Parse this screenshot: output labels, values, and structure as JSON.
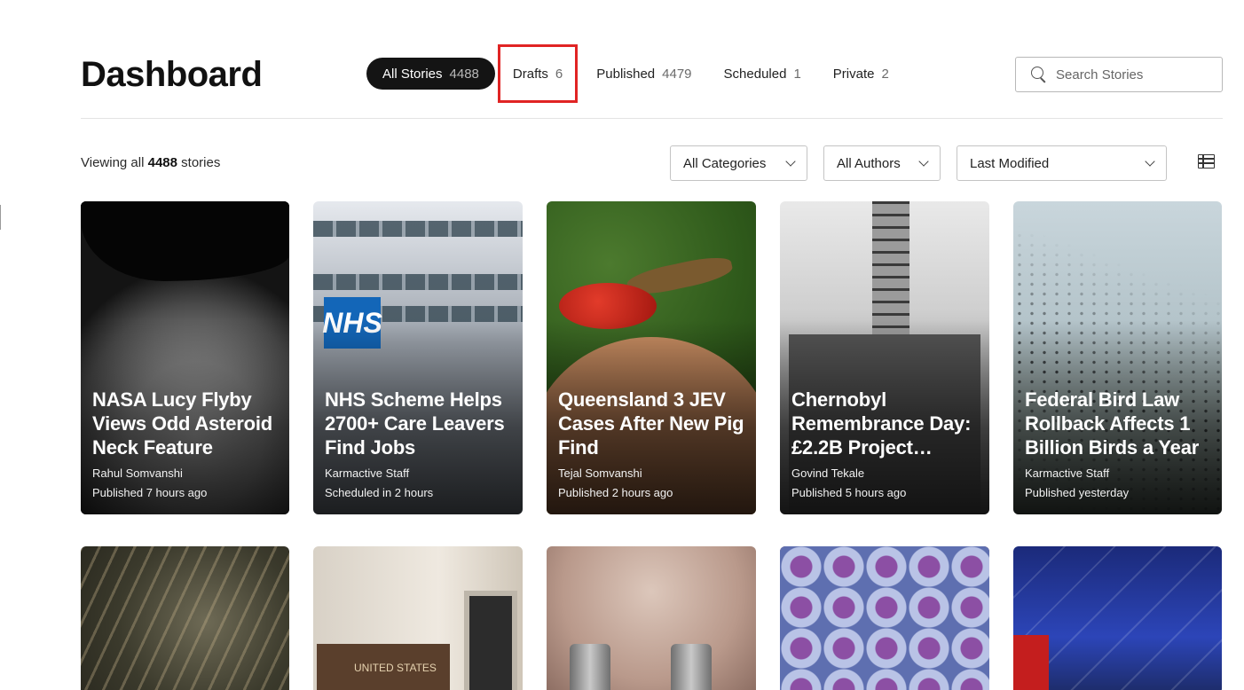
{
  "header": {
    "title": "Dashboard",
    "tabs": [
      {
        "label": "All Stories",
        "count": "4488"
      },
      {
        "label": "Drafts",
        "count": "6"
      },
      {
        "label": "Published",
        "count": "4479"
      },
      {
        "label": "Scheduled",
        "count": "1"
      },
      {
        "label": "Private",
        "count": "2"
      }
    ],
    "search": {
      "placeholder": "Search Stories"
    }
  },
  "filters": {
    "viewing_prefix": "Viewing all",
    "viewing_count": "4488",
    "viewing_suffix": "stories",
    "category": "All Categories",
    "author": "All Authors",
    "sort": "Last Modified"
  },
  "stories": [
    {
      "title": "NASA Lucy Flyby Views Odd Asteroid Neck Feature",
      "author": "Rahul Somvanshi",
      "status": "Published 7 hours ago"
    },
    {
      "title": "NHS Scheme Helps 2700+ Care Leavers Find Jobs",
      "author": "Karmactive Staff",
      "status": "Scheduled in 2 hours"
    },
    {
      "title": "Queensland 3 JEV Cases After New Pig Find",
      "author": "Tejal Somvanshi",
      "status": "Published 2 hours ago"
    },
    {
      "title": "Chernobyl Remembrance Day: £2.2B Project…",
      "author": "Govind Tekale",
      "status": "Published 5 hours ago"
    },
    {
      "title": "Federal Bird Law Rollback Affects 1 Billion Birds a Year",
      "author": "Karmactive Staff",
      "status": "Published yesterday"
    }
  ],
  "image_text": {
    "nhs_logo": "NHS",
    "plaque": "UNITED STATES"
  },
  "colors": {
    "active_tab_bg": "#141414",
    "highlight_outline": "#e02424"
  }
}
